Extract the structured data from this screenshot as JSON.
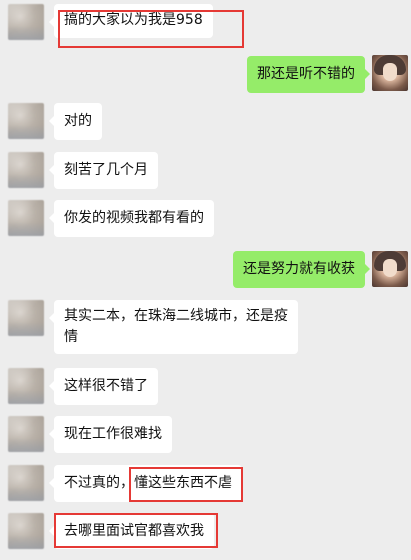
{
  "messages": [
    {
      "side": "in",
      "text": "搞的大家以为我是958"
    },
    {
      "side": "out",
      "text": "那还是听不错的"
    },
    {
      "side": "in",
      "text": "对的"
    },
    {
      "side": "in",
      "text": "刻苦了几个月"
    },
    {
      "side": "in",
      "text": "你发的视频我都有看的"
    },
    {
      "side": "out",
      "text": "还是努力就有收获"
    },
    {
      "side": "in",
      "text": "其实二本，在珠海二线城市，还是疫情"
    },
    {
      "side": "in",
      "text": "这样很不错了"
    },
    {
      "side": "in",
      "text": "现在工作很难找"
    },
    {
      "side": "in",
      "text": "不过真的，懂这些东西不虐"
    },
    {
      "side": "in",
      "text": "去哪里面试官都喜欢我"
    }
  ],
  "highlight_color": "#e53935",
  "bubble_colors": {
    "incoming": "#ffffff",
    "outgoing": "#95ec69",
    "background": "#ededed"
  }
}
